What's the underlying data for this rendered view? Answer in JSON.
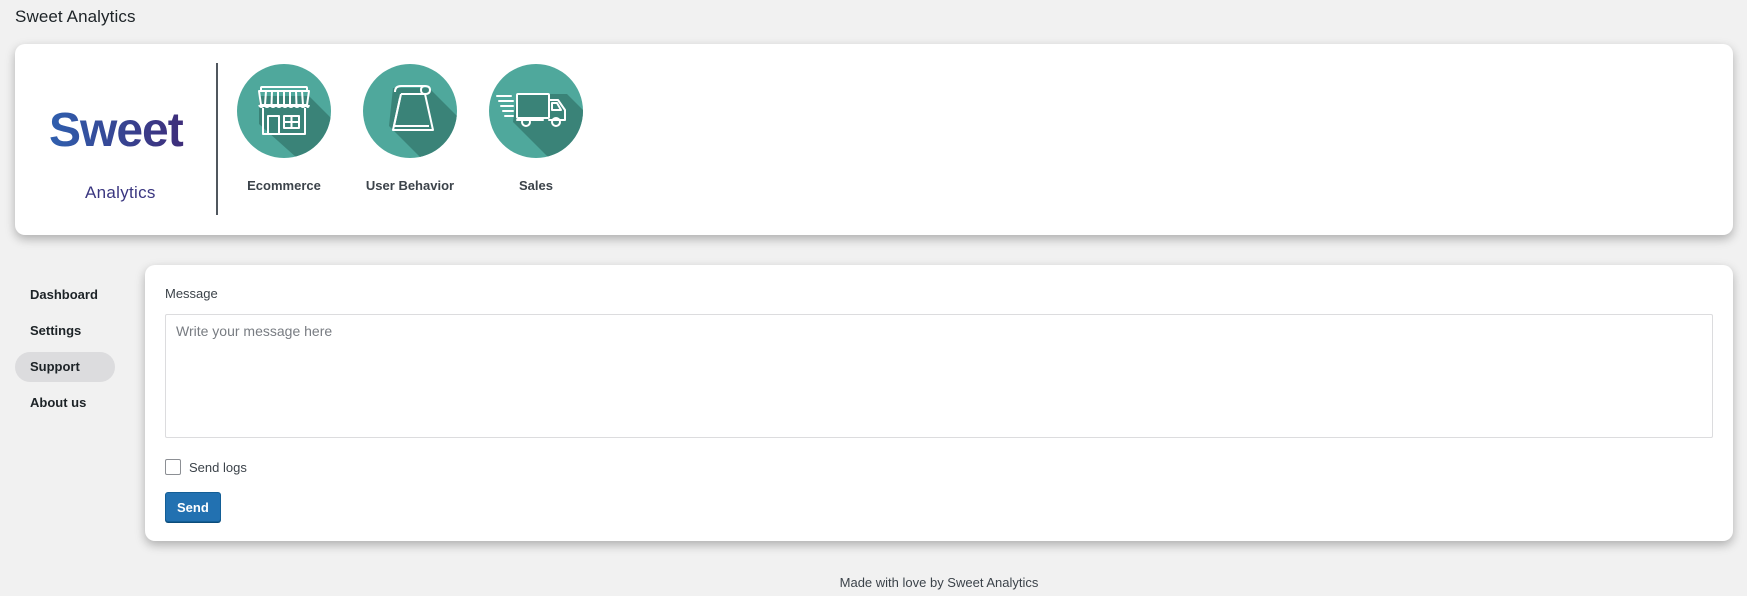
{
  "page": {
    "title": "Sweet Analytics"
  },
  "logo": {
    "word": "Sweet",
    "sub": "Analytics"
  },
  "apps": [
    {
      "label": "Ecommerce",
      "icon": "storefront-icon"
    },
    {
      "label": "User Behavior",
      "icon": "scroll-icon"
    },
    {
      "label": "Sales",
      "icon": "delivery-truck-icon"
    }
  ],
  "sidebar": {
    "items": [
      {
        "label": "Dashboard"
      },
      {
        "label": "Settings"
      },
      {
        "label": "Support",
        "active": true
      },
      {
        "label": "About us"
      }
    ]
  },
  "form": {
    "message_label": "Message",
    "message_value": "",
    "message_placeholder": "Write your message here",
    "send_logs_label": "Send logs",
    "send_logs_checked": false,
    "send_label": "Send"
  },
  "footer": {
    "text": "Made with love by Sweet Analytics"
  },
  "colors": {
    "icon_bg": "#4fa89c",
    "icon_shadow": "#3a8378",
    "primary_button": "#2271b1",
    "logo_blue": "#2b4da0",
    "logo_purple": "#3a3680"
  }
}
